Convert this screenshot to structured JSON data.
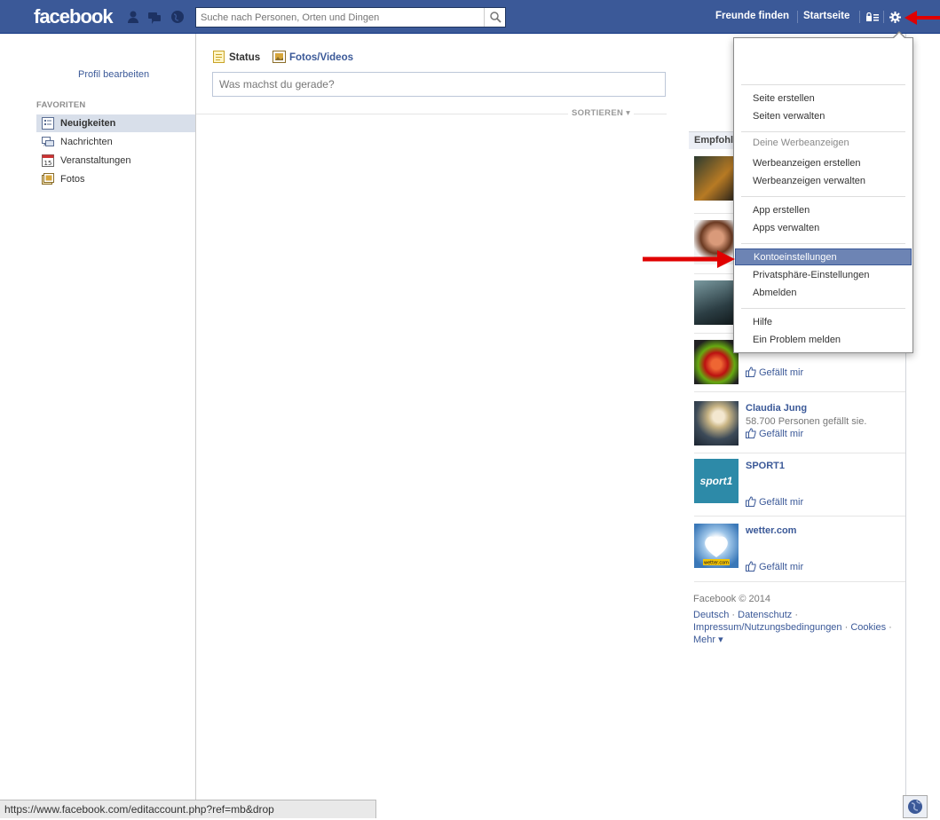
{
  "header": {
    "logo": "facebook",
    "search_placeholder": "Suche nach Personen, Orten und Dingen",
    "find_friends": "Freunde finden",
    "home": "Startseite"
  },
  "leftnav": {
    "edit_profile": "Profil bearbeiten",
    "favorites_heading": "FAVORITEN",
    "items": [
      {
        "label": "Neuigkeiten",
        "icon": "news-feed-icon"
      },
      {
        "label": "Nachrichten",
        "icon": "messages-icon"
      },
      {
        "label": "Veranstaltungen",
        "icon": "calendar-icon",
        "badge": "15"
      },
      {
        "label": "Fotos",
        "icon": "photos-icon"
      }
    ]
  },
  "composer": {
    "tab_status": "Status",
    "tab_photos": "Fotos/Videos",
    "placeholder": "Was machst du gerade?",
    "sort": "SORTIEREN"
  },
  "rightcol": {
    "heading": "Empfohlen",
    "like_label": "Gefällt mir",
    "pages": [
      {
        "name": "Claudia Jung",
        "meta": "58.700 Personen gefällt sie."
      },
      {
        "name": "SPORT1",
        "meta": ""
      },
      {
        "name": "wetter.com",
        "meta": ""
      }
    ],
    "thumb_text": {
      "sport1": "sport1",
      "wetter": "wetter.com"
    }
  },
  "footer": {
    "copyright": "Facebook © 2014",
    "links": [
      "Deutsch",
      "Datenschutz",
      "Impressum/Nutzungsbedingungen",
      "Cookies",
      "Mehr"
    ]
  },
  "dropdown": {
    "sections": [
      [
        "Seite erstellen",
        "Seiten verwalten"
      ],
      [
        "Deine Werbeanzeigen",
        "Werbeanzeigen erstellen",
        "Werbeanzeigen verwalten"
      ],
      [
        "App erstellen",
        "Apps verwalten"
      ],
      [
        "Kontoeinstellungen",
        "Privatsphäre-Einstellungen",
        "Abmelden"
      ],
      [
        "Hilfe",
        "Ein Problem melden"
      ]
    ]
  },
  "statusbar": {
    "url": "https://www.facebook.com/editaccount.php?ref=mb&drop"
  },
  "colors": {
    "brand": "#3b5998",
    "highlight": "#6d84b4",
    "arrow": "#e00000"
  }
}
